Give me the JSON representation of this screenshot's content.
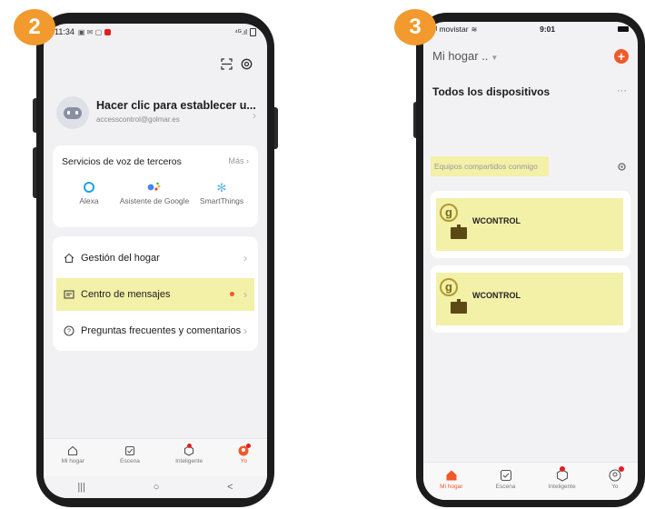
{
  "steps": {
    "left": "2",
    "right": "3"
  },
  "phone2": {
    "status": {
      "time": "11:34",
      "signal": "⁴ᴳ.ıl"
    },
    "header_icons": [
      "scan-icon",
      "settings-icon"
    ],
    "profile": {
      "name": "Hacer clic para establecer u...",
      "email": "accesscontrol@golmar.es"
    },
    "voice": {
      "title": "Servicios de voz de terceros",
      "more": "Más",
      "items": [
        {
          "label": "Alexa",
          "icon": "alexa-icon"
        },
        {
          "label": "Asistente de Google",
          "icon": "google-assistant-icon"
        },
        {
          "label": "SmartThings",
          "icon": "smartthings-icon"
        }
      ]
    },
    "menu": [
      {
        "label": "Gestión del hogar",
        "icon": "home-icon"
      },
      {
        "label": "Centro de mensajes",
        "icon": "message-icon"
      },
      {
        "label": "Preguntas frecuentes y comentarios",
        "icon": "help-icon"
      }
    ],
    "nav": [
      {
        "label": "Mi hogar"
      },
      {
        "label": "Escena"
      },
      {
        "label": "Inteligente"
      },
      {
        "label": "Yo"
      }
    ],
    "sysnav": [
      "|||",
      "○",
      "<"
    ]
  },
  "phone3": {
    "status": {
      "carrier": "movistar",
      "time": "9:01"
    },
    "home_selector": "Mi hogar ..",
    "section_title": "Todos los dispositivos",
    "more": "···",
    "shared_label": "Equipos compartidos conmigo",
    "devices": [
      {
        "name": "WCONTROL",
        "logo": "g"
      },
      {
        "name": "WCONTROL",
        "logo": "g"
      }
    ],
    "nav": [
      {
        "label": "Mi hogar"
      },
      {
        "label": "Escena"
      },
      {
        "label": "Inteligente"
      },
      {
        "label": "Yo"
      }
    ]
  },
  "colors": {
    "accent": "#f05a28",
    "highlight": "#f3f0a8",
    "step_badge": "#f29a2e",
    "frame": "#1c1c1c"
  }
}
